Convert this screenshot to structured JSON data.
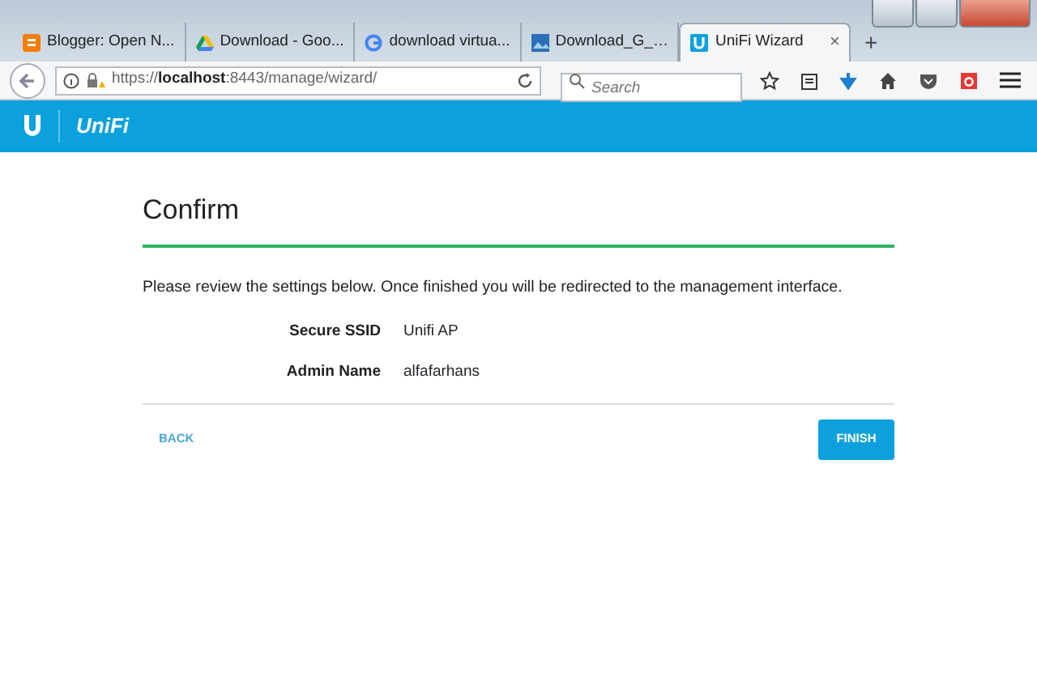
{
  "browser": {
    "tabs": [
      {
        "label": "Blogger: Open N...",
        "selected": false
      },
      {
        "label": "Download - Goo...",
        "selected": false
      },
      {
        "label": "download virtua...",
        "selected": false
      },
      {
        "label": "Download_G_…",
        "selected": false
      },
      {
        "label": "UniFi Wizard",
        "selected": true,
        "close": "×"
      }
    ],
    "new_tab": "+",
    "address": "https://**localhost**:8443/manage/wizard/",
    "search": {
      "placeholder": "Search"
    }
  },
  "header": {
    "brand": "UniFi"
  },
  "wizard": {
    "title": "Confirm",
    "intro": "Please review the settings below. Once finished you will be redirected to the management interface.",
    "fields": [
      {
        "label": "Secure SSID",
        "value": "Unifi AP"
      },
      {
        "label": "Admin Name",
        "value": "alfafarhans"
      }
    ],
    "back": "BACK",
    "finish": "FINISH"
  }
}
